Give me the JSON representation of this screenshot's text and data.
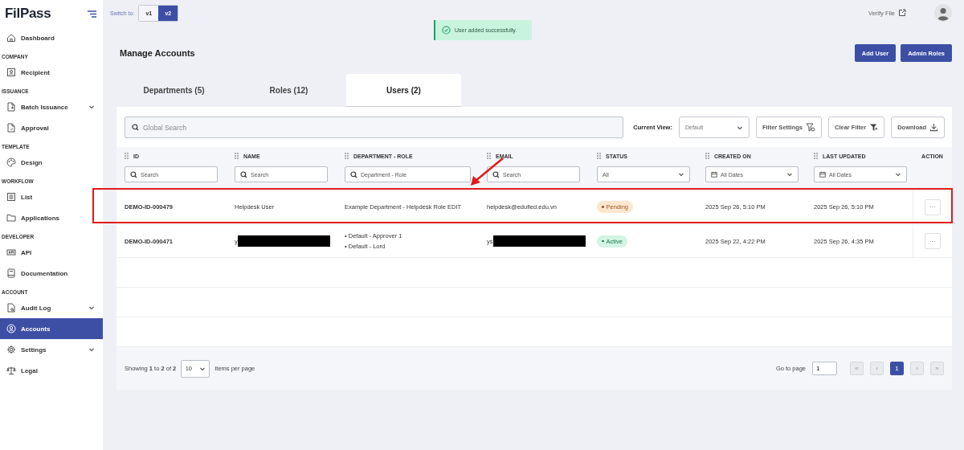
{
  "sidebar": {
    "logo": "FilPass",
    "groups": [
      {
        "items": [
          {
            "label": "Dashboard",
            "selected": false,
            "has_submenu": false
          }
        ]
      },
      {
        "heading": "COMPANY",
        "items": [
          {
            "label": "Recipient",
            "selected": false,
            "has_submenu": false
          }
        ]
      },
      {
        "heading": "ISSUANCE",
        "items": [
          {
            "label": "Batch Issuance",
            "selected": false,
            "has_submenu": true
          },
          {
            "label": "Approval",
            "selected": false,
            "has_submenu": false
          }
        ]
      },
      {
        "heading": "TEMPLATE",
        "items": [
          {
            "label": "Design",
            "selected": false,
            "has_submenu": false
          }
        ]
      },
      {
        "heading": "WORKFLOW",
        "items": [
          {
            "label": "List",
            "selected": false,
            "has_submenu": false
          },
          {
            "label": "Applications",
            "selected": false,
            "has_submenu": false
          }
        ]
      },
      {
        "heading": "DEVELOPER",
        "items": [
          {
            "label": "API",
            "selected": false,
            "has_submenu": false
          },
          {
            "label": "Documentation",
            "selected": false,
            "has_submenu": false
          }
        ]
      },
      {
        "heading": "ACCOUNT",
        "items": [
          {
            "label": "Audit Log",
            "selected": false,
            "has_submenu": true
          },
          {
            "label": "Accounts",
            "selected": true,
            "has_submenu": false
          }
        ]
      },
      {
        "items": [
          {
            "label": "Settings",
            "selected": false,
            "has_submenu": true
          },
          {
            "label": "Legal",
            "selected": false,
            "has_submenu": false
          }
        ]
      }
    ]
  },
  "top_bar": {
    "switch_label": "Switch to:",
    "versions": [
      {
        "label": "v1",
        "selected": false
      },
      {
        "label": "v2",
        "selected": true
      }
    ],
    "verify_link": "Verify File"
  },
  "toast": {
    "message": "User added successfully."
  },
  "page": {
    "title": "Manage Accounts",
    "buttons": [
      "Add User",
      "Admin Roles"
    ]
  },
  "tabs": [
    {
      "label": "Departments (5)",
      "selected": false
    },
    {
      "label": "Roles (12)",
      "selected": false
    },
    {
      "label": "Users (2)",
      "selected": true
    }
  ],
  "toolbar": {
    "search_placeholder": "Global Search",
    "view_label": "Current View:",
    "view_value": "Default",
    "buttons": [
      {
        "label": "Filter Settings",
        "kind": "filter-settings"
      },
      {
        "label": "Clear Filter",
        "kind": "clear-filter"
      },
      {
        "label": "Download",
        "kind": "download"
      }
    ]
  },
  "table": {
    "columns": [
      {
        "label": "ID",
        "draggable": true,
        "filter": {
          "kind": "search",
          "placeholder": "Search"
        }
      },
      {
        "label": "NAME",
        "draggable": true,
        "filter": {
          "kind": "search",
          "placeholder": "Search"
        }
      },
      {
        "label": "DEPARTMENT - ROLE",
        "draggable": true,
        "filter": {
          "kind": "search",
          "placeholder": "Department - Role"
        }
      },
      {
        "label": "EMAIL",
        "draggable": true,
        "filter": {
          "kind": "search",
          "placeholder": "Search"
        }
      },
      {
        "label": "STATUS",
        "draggable": true,
        "filter": {
          "kind": "select",
          "value": "All"
        }
      },
      {
        "label": "CREATED ON",
        "draggable": true,
        "filter": {
          "kind": "date",
          "value": "All Dates"
        }
      },
      {
        "label": "LAST UPDATED",
        "draggable": true,
        "filter": {
          "kind": "date",
          "value": "All Dates"
        }
      },
      {
        "label": "ACTION",
        "draggable": false
      }
    ],
    "rows": [
      {
        "id": "DEMO-ID-000479",
        "name": {
          "text": "Helpdesk User",
          "redacted": false
        },
        "department_roles": [
          "Example Department - Helpdesk Role EDIT"
        ],
        "email": {
          "text": "helpdesk@edufied.edu.vn",
          "redacted": false
        },
        "status": {
          "label": "Pending",
          "kind": "pending"
        },
        "created": "2025 Sep 26, 5:10 PM",
        "updated": "2025 Sep 26, 5:10 PM",
        "action": "···",
        "highlighted": true
      },
      {
        "id": "DEMO-ID-000471",
        "name": {
          "text": "y",
          "redacted": true
        },
        "department_roles": [
          "• Default - Approver 1",
          "• Default - Lord"
        ],
        "email": {
          "text": "ys",
          "redacted": true
        },
        "status": {
          "label": "Active",
          "kind": "active"
        },
        "created": "2025 Sep 22, 4:22 PM",
        "updated": "2025 Sep 26, 4:35 PM",
        "action": "···",
        "highlighted": false
      }
    ]
  },
  "pagination": {
    "summary": "Showing **1** to **2** of **2**",
    "per_page": "10",
    "per_page_label": "Items per page",
    "goto_label": "Go to page",
    "goto_value": "1",
    "pages": [
      {
        "label": "«",
        "selected": false,
        "disabled": true
      },
      {
        "label": "‹",
        "selected": false,
        "disabled": true
      },
      {
        "label": "1",
        "selected": true,
        "disabled": false
      },
      {
        "label": "›",
        "selected": false,
        "disabled": true
      },
      {
        "label": "»",
        "selected": false,
        "disabled": true
      }
    ]
  }
}
